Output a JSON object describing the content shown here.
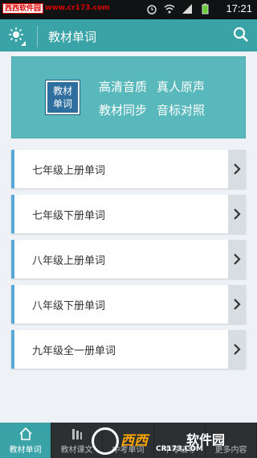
{
  "status_bar": {
    "watermark_label": "西西软件园",
    "watermark_url": "www.cr173.com",
    "time": "17:21"
  },
  "app_bar": {
    "title": "教材单词",
    "menu_icon": "sun-icon",
    "search_icon": "search-icon"
  },
  "banner": {
    "logo_text_line1": "教材",
    "logo_text_line2": "单词",
    "feature1": "高清音质",
    "feature2": "真人原声",
    "feature3": "教材同步",
    "feature4": "音标对照"
  },
  "list": {
    "items": [
      {
        "label": "七年级上册单词"
      },
      {
        "label": "七年级下册单词"
      },
      {
        "label": "八年级上册单词"
      },
      {
        "label": "八年级下册单词"
      },
      {
        "label": "九年级全一册单词"
      }
    ]
  },
  "bottom_nav": {
    "tabs": [
      {
        "label": "教材单词",
        "active": true
      },
      {
        "label": "教材课文"
      },
      {
        "label": "中考单词"
      },
      {
        "label": "中考辅导"
      },
      {
        "label": "更多内容"
      }
    ]
  },
  "bottom_watermark": {
    "text1": "西西",
    "text2": "软件园",
    "url": "CR173.COM"
  },
  "colors": {
    "accent": "#3aa3a7",
    "banner": "#58b8bb",
    "list_stripe": "#5aa8d8",
    "background": "#eef2f6"
  }
}
